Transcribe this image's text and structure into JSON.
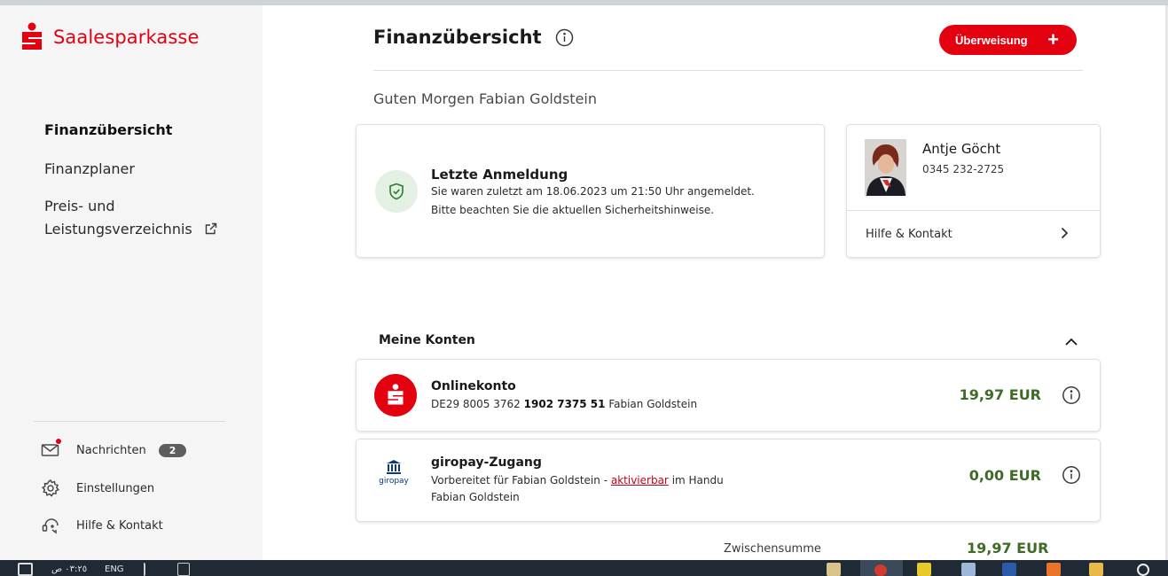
{
  "brand": {
    "name": "Saalesparkasse",
    "color": "#e3000f"
  },
  "sidebar": {
    "nav": [
      {
        "label": "Finanzübersicht",
        "active": true
      },
      {
        "label": "Finanzplaner",
        "active": false
      },
      {
        "label_line1": "Preis- und",
        "label_line2": "Leistungsverzeichnis",
        "icon": "external-link-icon"
      }
    ],
    "bottom_links": [
      {
        "label": "Nachrichten",
        "icon": "mail-icon",
        "badge": "2"
      },
      {
        "label": "Einstellungen",
        "icon": "gear-icon"
      },
      {
        "label": "Hilfe & Kontakt",
        "icon": "help-contact-icon"
      }
    ]
  },
  "header": {
    "title": "Finanzübersicht",
    "transfer_button": "Überweisung",
    "transfer_icon": "plus-icon"
  },
  "greeting": "Guten Morgen Fabian Goldstein",
  "last_login": {
    "title": "Letzte Anmeldung",
    "line1": "Sie waren zuletzt am 18.06.2023 um 21:50 Uhr angemeldet.",
    "line2": "Bitte beachten Sie die aktuellen Sicherheitshinweise.",
    "icon": "shield-check-icon"
  },
  "advisor": {
    "name": "Antje Göcht",
    "phone": "0345 232-2725",
    "link": "Hilfe & Kontakt"
  },
  "accounts_section": {
    "title": "Meine Konten",
    "accounts": [
      {
        "name": "Onlinekonto",
        "iban_prefix": "DE29 8005 3762",
        "iban_bold": "1902 7375 51",
        "holder": "Fabian Goldstein",
        "amount": "19,97 EUR"
      },
      {
        "name": "giropay-Zugang",
        "line1_prefix": "Vorbereitet für Fabian Goldstein -",
        "line1_link": "aktivierbar",
        "line1_suffix": "im Handu",
        "line2": "Fabian Goldstein",
        "logo_text": "giropay",
        "amount": "0,00 EUR"
      }
    ],
    "subtotal_label": "Zwischensumme",
    "subtotal_value": "19,97 EUR"
  },
  "taskbar": {
    "clock": "٠٣:٢٥ ص",
    "lang": "ENG"
  },
  "colors": {
    "amount_green": "#3e6c27",
    "accent_red": "#e3000f"
  }
}
